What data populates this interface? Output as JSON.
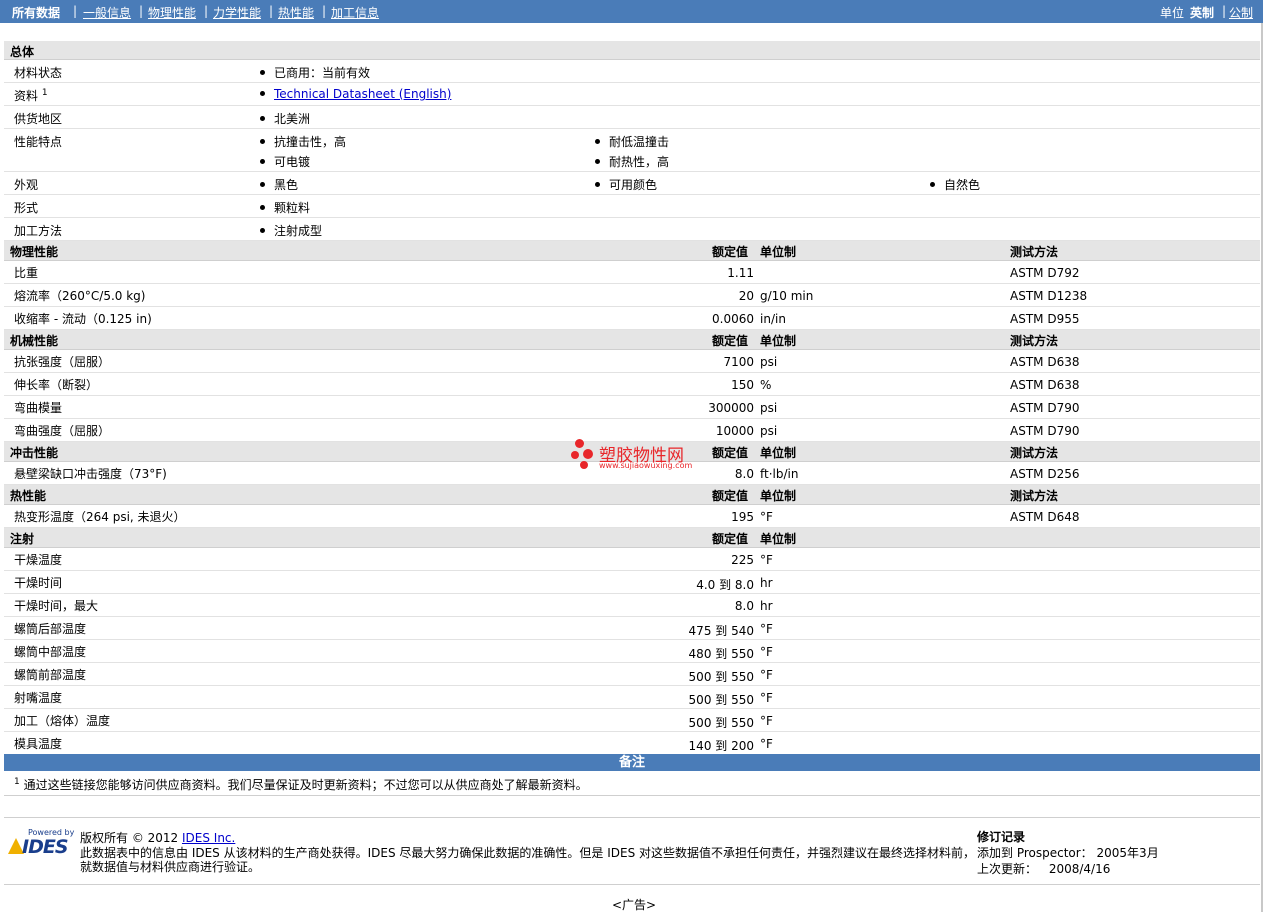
{
  "nav": {
    "all_data": "所有数据",
    "general": "一般信息",
    "physical": "物理性能",
    "mechanical": "力学性能",
    "thermal": "热性能",
    "processing": "加工信息",
    "unit_label": "单位",
    "imperial": "英制",
    "metric": "公制",
    "sep": "|"
  },
  "general": {
    "title": "总体",
    "rows": [
      {
        "label": "材料状态",
        "values": [
          "已商用：当前有效"
        ]
      },
      {
        "label": "资料",
        "sup": "1",
        "values": [
          "Technical Datasheet (English)"
        ]
      },
      {
        "label": "供货地区",
        "values": [
          "北美洲"
        ]
      },
      {
        "label": "性能特点",
        "values": [
          "抗撞击性，高",
          "耐低温撞击",
          "可电镀",
          "耐热性，高"
        ]
      },
      {
        "label": "外观",
        "values": [
          "黑色",
          "可用颜色",
          "自然色"
        ]
      },
      {
        "label": "形式",
        "values": [
          "颗粒料"
        ]
      },
      {
        "label": "加工方法",
        "values": [
          "注射成型"
        ]
      }
    ]
  },
  "headers": {
    "nominal": "额定值",
    "unit": "单位制",
    "method": "测试方法"
  },
  "physical": {
    "title": "物理性能",
    "rows": [
      {
        "label": "比重",
        "value": "1.11",
        "unit": "",
        "method": "ASTM D792"
      },
      {
        "label": "熔流率（260°C/5.0 kg)",
        "value": "20",
        "unit": "g/10 min",
        "method": "ASTM D1238"
      },
      {
        "label": "收缩率 - 流动（0.125 in)",
        "value": "0.0060",
        "unit": "in/in",
        "method": "ASTM D955"
      }
    ]
  },
  "mechanical": {
    "title": "机械性能",
    "rows": [
      {
        "label": "抗张强度（屈服）",
        "value": "7100",
        "unit": "psi",
        "method": "ASTM D638"
      },
      {
        "label": "伸长率（断裂）",
        "value": "150",
        "unit": "%",
        "method": "ASTM D638"
      },
      {
        "label": "弯曲模量",
        "value": "300000",
        "unit": "psi",
        "method": "ASTM D790"
      },
      {
        "label": "弯曲强度（屈服）",
        "value": "10000",
        "unit": "psi",
        "method": "ASTM D790"
      }
    ]
  },
  "impact": {
    "title": "冲击性能",
    "rows": [
      {
        "label": "悬壁梁缺口冲击强度（73°F)",
        "value": "8.0",
        "unit": "ft·lb/in",
        "method": "ASTM D256"
      }
    ]
  },
  "thermal": {
    "title": "热性能",
    "rows": [
      {
        "label": "热变形温度（264 psi, 未退火）",
        "value": "195",
        "unit": "°F",
        "method": "ASTM D648"
      }
    ]
  },
  "injection": {
    "title": "注射",
    "rows": [
      {
        "label": "干燥温度",
        "value": "225",
        "unit": "°F"
      },
      {
        "label": "干燥时间",
        "value": "4.0 到  8.0",
        "unit": "hr"
      },
      {
        "label": "干燥时间，最大",
        "value": "8.0",
        "unit": "hr"
      },
      {
        "label": "螺筒后部温度",
        "value": "475 到  540",
        "unit": "°F"
      },
      {
        "label": "螺筒中部温度",
        "value": "480 到  550",
        "unit": "°F"
      },
      {
        "label": "螺筒前部温度",
        "value": "500 到  550",
        "unit": "°F"
      },
      {
        "label": "射嘴温度",
        "value": "500 到  550",
        "unit": "°F"
      },
      {
        "label": "加工（熔体）温度",
        "value": "500 到  550",
        "unit": "°F"
      },
      {
        "label": "模具温度",
        "value": "140 到  200",
        "unit": "°F"
      }
    ]
  },
  "notes": {
    "title": "备注",
    "sup": "1",
    "text": "通过这些链接您能够访问供应商资料。我们尽量保证及时更新资料；不过您可以从供应商处了解最新资料。"
  },
  "watermark": {
    "text": "塑胶物性网",
    "url": "www.sujiaowuxing.com"
  },
  "footer": {
    "logo_powered": "Powered by",
    "logo_name": "IDES",
    "copyright_prefix": "版权所有  © 2012 ",
    "copyright_link": "IDES Inc.",
    "line2": "此数据表中的信息由  IDES 从该材料的生产商处获得。IDES 尽最大努力确保此数据的准确性。但是  IDES 对这些数据值不承担任何责任，并强烈建议在最终选择材料前，",
    "line3": "就数据值与材料供应商进行验证。",
    "rev_title": "修订记录",
    "added_label": "添加到  Prospector：",
    "added_value": "2005年3月",
    "updated_label": "上次更新：",
    "updated_value": "2008/4/16",
    "ad": "<广告>"
  }
}
